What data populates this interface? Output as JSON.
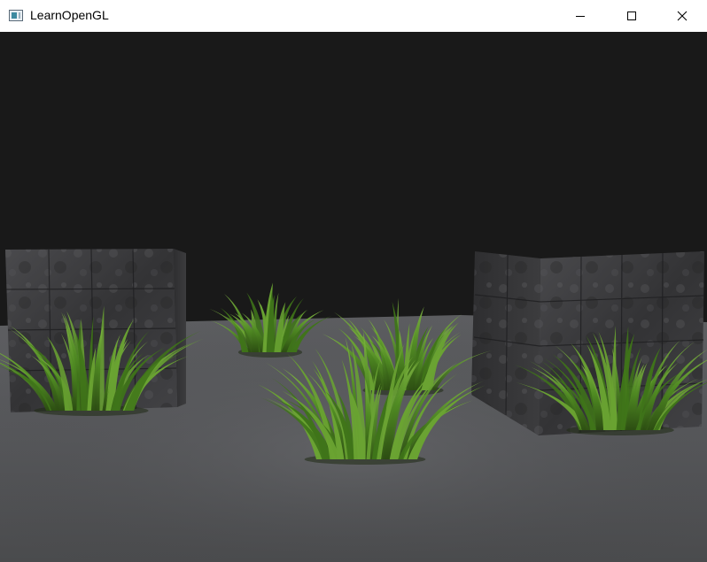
{
  "window": {
    "title": "LearnOpenGL",
    "app_icon": "opengl-app-icon",
    "controls": {
      "minimize_icon": "minimize-icon",
      "maximize_icon": "maximize-icon",
      "close_icon": "close-icon"
    }
  },
  "scene": {
    "clear_color": "#191919",
    "floor_color": "#585858",
    "cube_color": "#3a3a3c",
    "grass_color": "#4f8a22",
    "objects": [
      "marble-cube",
      "marble-cube",
      "grass-quad",
      "grass-quad",
      "grass-quad",
      "grass-quad",
      "grass-quad"
    ]
  }
}
